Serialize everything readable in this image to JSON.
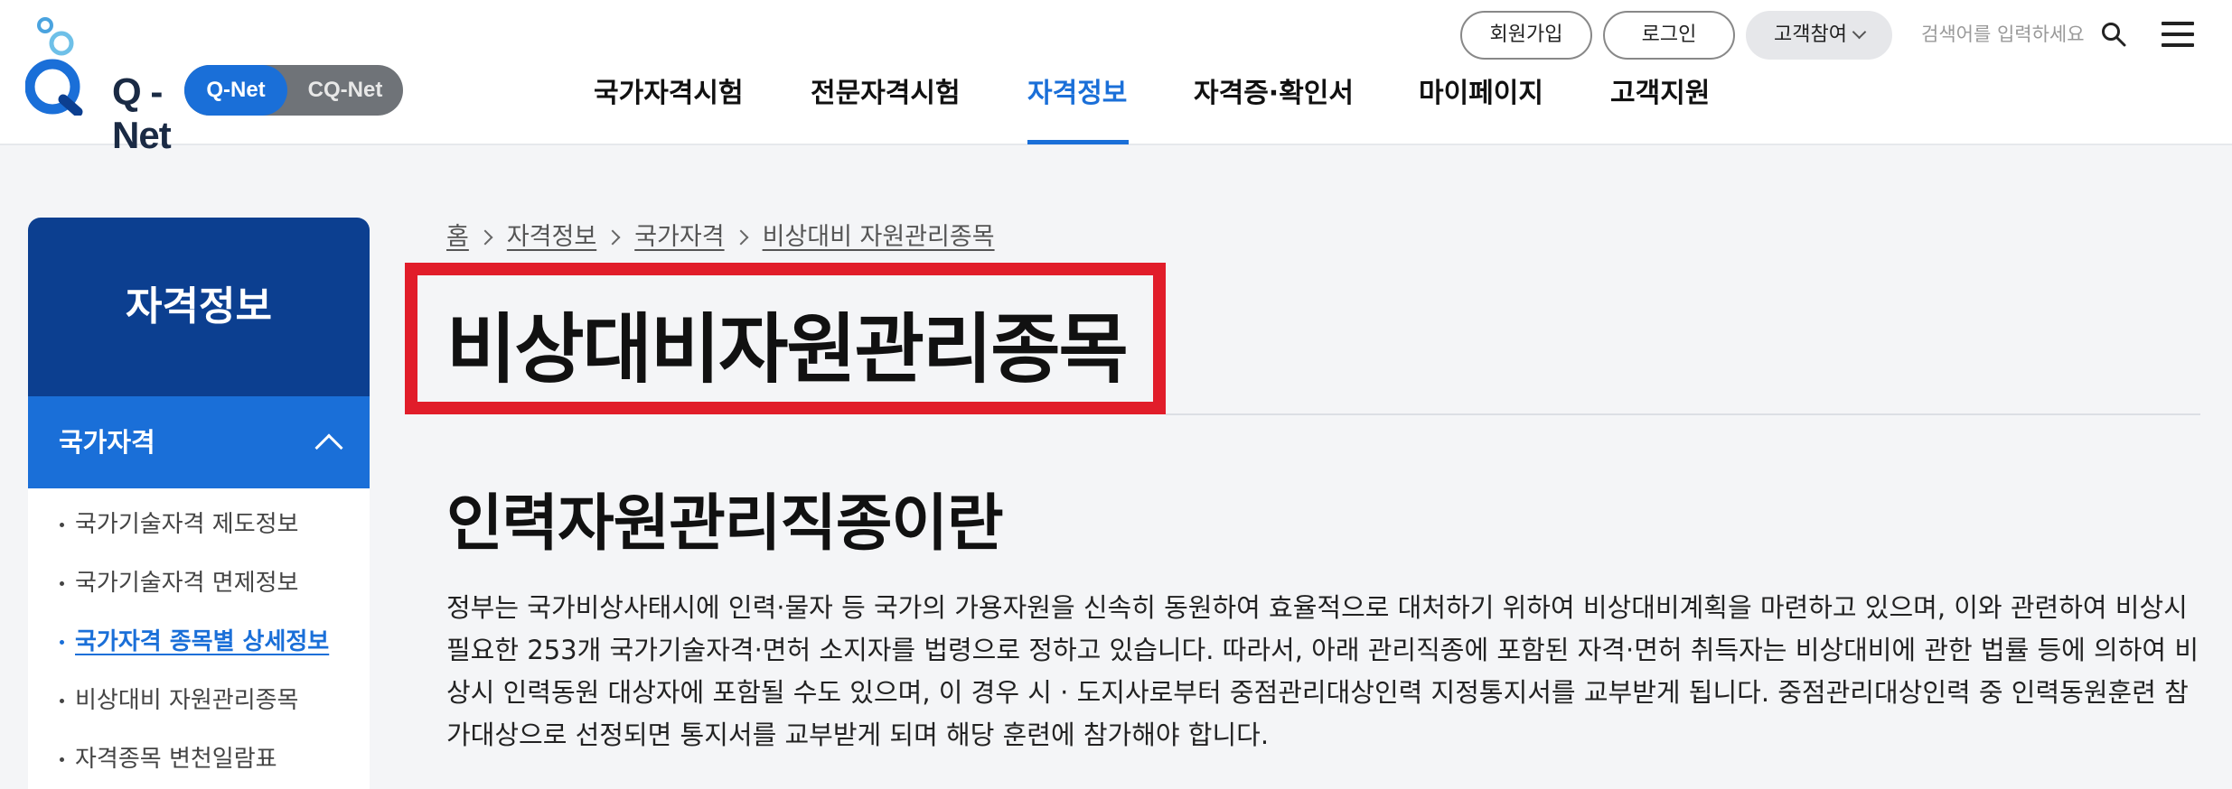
{
  "header": {
    "logo_text": "Q - Net",
    "site_switch": {
      "active": "Q-Net",
      "other": "CQ-Net"
    },
    "top_buttons": {
      "join": "회원가입",
      "login": "로그인",
      "customer": "고객참여"
    },
    "search_placeholder": "검색어를 입력하세요",
    "nav": [
      "국가자격시험",
      "전문자격시험",
      "자격정보",
      "자격증·확인서",
      "마이페이지",
      "고객지원"
    ],
    "nav_active": "자격정보",
    "colors": {
      "accent": "#1a6fd8",
      "sidebar_title_bg": "#0c3f90",
      "highlight_box": "#e11d2a"
    }
  },
  "sidebar": {
    "title": "자격정보",
    "category": "국가자격",
    "items": [
      "국가기술자격 제도정보",
      "국가기술자격 면제정보",
      "국가자격 종목별 상세정보",
      "비상대비 자원관리종목",
      "자격종목 변천일람표"
    ],
    "active_item": "국가자격 종목별 상세정보"
  },
  "breadcrumb": [
    "홈",
    "자격정보",
    "국가자격",
    "비상대비 자원관리종목"
  ],
  "main": {
    "page_title": "비상대비자원관리종목",
    "section_title": "인력자원관리직종이란",
    "paragraph": "정부는 국가비상사태시에 인력·물자 등 국가의 가용자원을 신속히 동원하여 효율적으로 대처하기 위하여 비상대비계획을 마련하고 있으며, 이와 관련하여 비상시 필요한 253개 국가기술자격·면허 소지자를 법령으로 정하고 있습니다. 따라서, 아래 관리직종에 포함된 자격·면허 취득자는 비상대비에 관한 법률 등에 의하여 비상시 인력동원 대상자에 포함될 수도 있으며, 이 경우 시 · 도지사로부터 중점관리대상인력 지정통지서를 교부받게 됩니다. 중점관리대상인력 중 인력동원훈련 참가대상으로 선정되면 통지서를 교부받게 되며 해당 훈련에 참가해야 합니다."
  }
}
